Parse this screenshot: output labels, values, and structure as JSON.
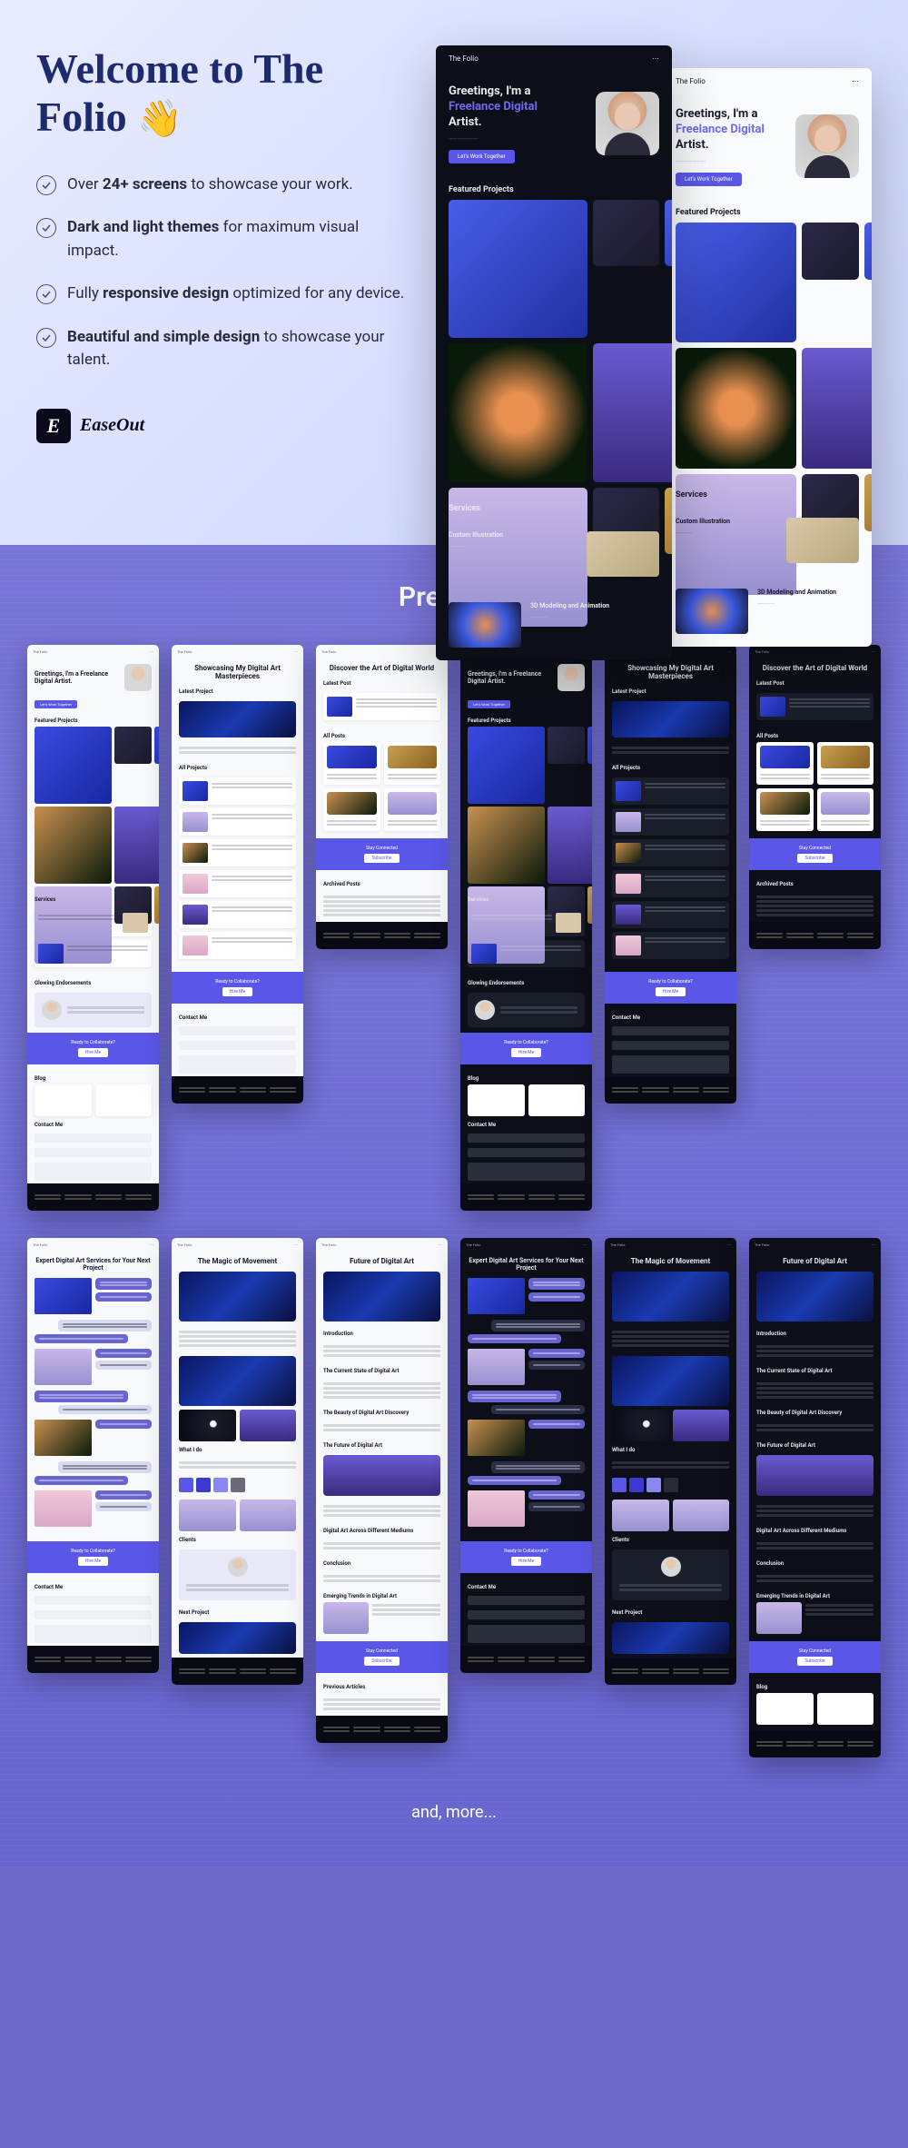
{
  "hero": {
    "title_line1": "Welcome to The",
    "title_line2": "Folio",
    "wave": "👋",
    "features": [
      {
        "pre": "Over ",
        "bold": "24+ screens",
        "post": " to showcase your work."
      },
      {
        "pre": "",
        "bold": "Dark and light themes",
        "post": " for maximum visual impact."
      },
      {
        "pre": "Fully ",
        "bold": "responsive design",
        "post": " optimized for any device."
      },
      {
        "pre": "",
        "bold": "Beautiful and simple design",
        "post": " to showcase your talent."
      }
    ],
    "brand": {
      "logo_letter": "E",
      "name": "EaseOut"
    },
    "mockup": {
      "logo": "The Folio",
      "hero_line1": "Greetings, I'm a",
      "hero_line2_accent": "Freelance Digital",
      "hero_line3": "Artist.",
      "button": "Let's Work Together",
      "featured": "Featured Projects",
      "services": "Services",
      "service1_title": "Custom Illustration",
      "service2_title": "3D Modeling and Animation"
    }
  },
  "previews": {
    "title": "Previews",
    "more": "and, more...",
    "row1": [
      {
        "theme": "light",
        "title": "Greetings, I'm a Freelance Digital Artist."
      },
      {
        "theme": "light",
        "title": "Showcasing My Digital Art Masterpieces"
      },
      {
        "theme": "light",
        "title": "Discover the Art of Digital World"
      },
      {
        "theme": "dark",
        "title": "Greetings, I'm a Freelance Digital Artist."
      },
      {
        "theme": "dark",
        "title": "Showcasing My Digital Art Masterpieces"
      },
      {
        "theme": "dark",
        "title": "Discover the Art of Digital World"
      }
    ],
    "row2": [
      {
        "theme": "light",
        "title": "Expert Digital Art Services for Your Next Project"
      },
      {
        "theme": "light",
        "title": "The Magic of Movement"
      },
      {
        "theme": "light",
        "title": "Future of Digital Art"
      },
      {
        "theme": "dark",
        "title": "Expert Digital Art Services for Your Next Project"
      },
      {
        "theme": "dark",
        "title": "The Magic of Movement"
      },
      {
        "theme": "dark",
        "title": "Future of Digital Art"
      }
    ],
    "labels": {
      "featured": "Featured Projects",
      "latest": "Latest Project",
      "latest_post": "Latest Post",
      "services": "Services",
      "endorsements": "Glowing Endorsements",
      "ready": "Ready to Collaborate?",
      "hire": "Hire Me",
      "blog": "Blog",
      "contact": "Contact Me",
      "stay": "Stay Connected",
      "subscribe": "Subscribe",
      "archived": "Archived Posts",
      "all_posts": "All Posts",
      "next_project": "Next Project",
      "what_i_do": "What I do",
      "intro": "Introduction",
      "current_state": "The Current State of Digital Art",
      "beauty": "The Beauty of Digital Art Discovery",
      "future": "The Future of Digital Art",
      "across": "Digital Art Across Different Mediums",
      "conclusion": "Conclusion",
      "emerging": "Emerging Trends in Digital Art",
      "previous": "Previous Articles",
      "clients": "Clients",
      "all_projects": "All Projects"
    }
  }
}
